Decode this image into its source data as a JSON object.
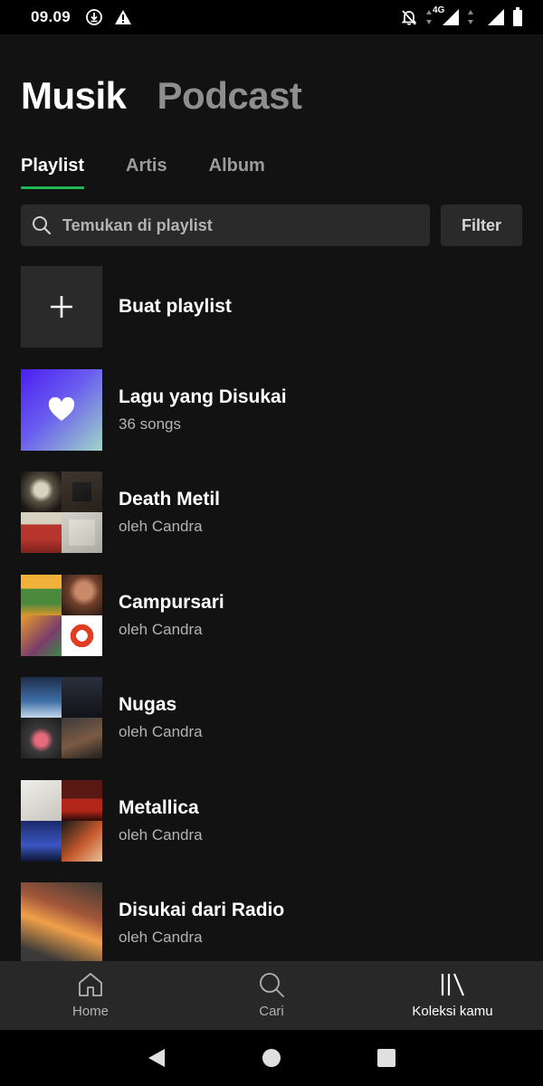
{
  "status_bar": {
    "time": "09.09",
    "network_label": "4G"
  },
  "header": {
    "tabs": [
      {
        "label": "Musik",
        "active": true
      },
      {
        "label": "Podcast",
        "active": false
      }
    ]
  },
  "subtabs": [
    {
      "label": "Playlist",
      "active": true
    },
    {
      "label": "Artis",
      "active": false
    },
    {
      "label": "Album",
      "active": false
    }
  ],
  "search": {
    "placeholder": "Temukan di playlist",
    "value": "",
    "filter_label": "Filter"
  },
  "playlists": [
    {
      "title": "Buat playlist",
      "subtitle": "",
      "thumb": "plus-icon"
    },
    {
      "title": "Lagu yang Disukai",
      "subtitle": "36 songs",
      "thumb": "heart-icon"
    },
    {
      "title": "Death Metil",
      "subtitle": "oleh Candra",
      "thumb": "mosaic"
    },
    {
      "title": "Campursari",
      "subtitle": "oleh Candra",
      "thumb": "mosaic"
    },
    {
      "title": "Nugas",
      "subtitle": "oleh Candra",
      "thumb": "mosaic"
    },
    {
      "title": "Metallica",
      "subtitle": "oleh Candra",
      "thumb": "mosaic"
    },
    {
      "title": "Disukai dari Radio",
      "subtitle": "oleh Candra",
      "thumb": "cover"
    }
  ],
  "bottom_nav": [
    {
      "label": "Home",
      "icon": "home-icon",
      "active": false
    },
    {
      "label": "Cari",
      "icon": "search-icon",
      "active": false
    },
    {
      "label": "Koleksi kamu",
      "icon": "library-icon",
      "active": true
    }
  ],
  "colors": {
    "background": "#121212",
    "accent": "#1db954",
    "surface": "#2a2a2a",
    "nav_bar": "#282828"
  }
}
